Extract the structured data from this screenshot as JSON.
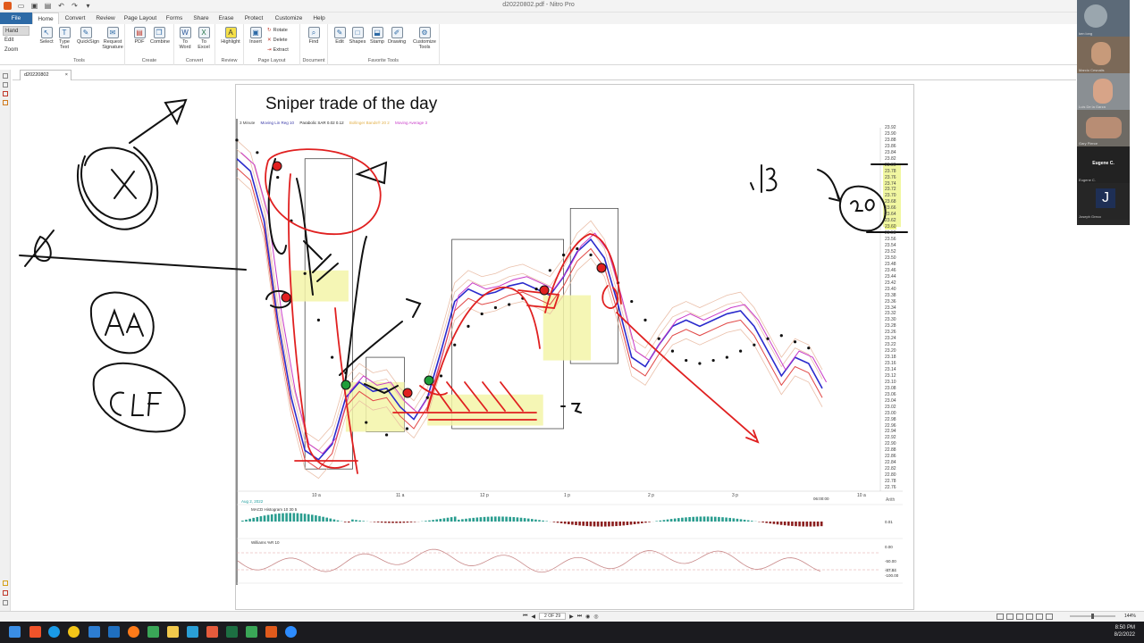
{
  "app": {
    "window_title": "d20220802.pdf - Nitro Pro"
  },
  "menu": {
    "tabs": [
      "File",
      "Home",
      "Convert",
      "Review",
      "Page Layout",
      "Forms",
      "Share",
      "Erase",
      "Protect",
      "Customize",
      "Help"
    ],
    "active": "Home"
  },
  "ribbon": {
    "hand_tools": [
      "Hand",
      "Edit",
      "Zoom"
    ],
    "groups": {
      "tools": {
        "label": "Tools",
        "buttons": [
          "Select",
          "Type Text",
          "QuickSign",
          "Request Signature"
        ]
      },
      "create": {
        "label": "Create",
        "buttons": [
          "PDF",
          "Combine"
        ]
      },
      "convert": {
        "label": "Convert",
        "buttons": [
          "To Word",
          "To Excel"
        ]
      },
      "review": {
        "label": "Review",
        "buttons": [
          "Highlight"
        ]
      },
      "page_layout": {
        "label": "Page Layout",
        "buttons": [
          "Insert"
        ],
        "small": [
          "Rotate",
          "Delete",
          "Extract"
        ]
      },
      "document": {
        "label": "Document",
        "buttons": [
          "Find"
        ]
      },
      "favorite": {
        "label": "Favorite Tools",
        "buttons": [
          "Edit",
          "Shapes",
          "Stamp",
          "Drawing",
          "Customize Tools"
        ]
      }
    }
  },
  "doc_tab": {
    "name": "d20220802",
    "close": "×"
  },
  "page": {
    "title": "Sniper trade of the day"
  },
  "chart": {
    "legend": [
      "3 Minute",
      "Moving Lin Reg 10",
      "Parabolic SAR 0.02 0.12",
      "Bollinger Bands® 20 2",
      "Moving Average 3"
    ],
    "arith": "Arith",
    "date_label": "Aug 2, 2022",
    "last_time": "06:00:00",
    "macd_label": "MACD Histogram 10 30 5",
    "williams_label": "Williams %R 10",
    "macd_value": "0.01",
    "williams_values": [
      "0.00",
      "-50.00",
      "-87.84",
      "-100.00"
    ]
  },
  "chart_data": {
    "type": "line",
    "title": "Sniper trade of the day",
    "x_ticks": [
      "10 a",
      "11 a",
      "12 p",
      "1 p",
      "2 p",
      "3 p",
      "10 a"
    ],
    "y_ticks": [
      "23.92",
      "23.90",
      "23.88",
      "23.86",
      "23.84",
      "23.82",
      "23.80",
      "23.78",
      "23.76",
      "23.74",
      "23.72",
      "23.70",
      "23.68",
      "23.66",
      "23.64",
      "23.62",
      "23.60",
      "23.58",
      "23.56",
      "23.54",
      "23.52",
      "23.50",
      "23.48",
      "23.46",
      "23.44",
      "23.42",
      "23.40",
      "23.38",
      "23.36",
      "23.34",
      "23.32",
      "23.30",
      "23.28",
      "23.26",
      "23.24",
      "23.22",
      "23.20",
      "23.18",
      "23.16",
      "23.14",
      "23.12",
      "23.10",
      "23.08",
      "23.06",
      "23.04",
      "23.02",
      "23.00",
      "22.98",
      "22.96",
      "22.94",
      "22.92",
      "22.90",
      "22.88",
      "22.86",
      "22.84",
      "22.82",
      "22.80",
      "22.78",
      "22.76"
    ],
    "ylim": [
      22.76,
      23.92
    ],
    "series": [
      {
        "name": "Moving Lin Reg 10",
        "points": [
          [
            0,
            23.82
          ],
          [
            10,
            23.78
          ],
          [
            20,
            23.62
          ],
          [
            30,
            23.3
          ],
          [
            40,
            23.05
          ],
          [
            50,
            22.88
          ],
          [
            60,
            22.85
          ],
          [
            70,
            22.9
          ],
          [
            80,
            23.05
          ],
          [
            90,
            23.1
          ],
          [
            100,
            23.07
          ],
          [
            110,
            23.08
          ],
          [
            120,
            23.02
          ],
          [
            130,
            22.98
          ],
          [
            140,
            23.05
          ],
          [
            150,
            23.2
          ],
          [
            160,
            23.36
          ],
          [
            170,
            23.4
          ],
          [
            180,
            23.38
          ],
          [
            190,
            23.39
          ],
          [
            200,
            23.41
          ],
          [
            210,
            23.42
          ],
          [
            220,
            23.4
          ],
          [
            230,
            23.38
          ],
          [
            240,
            23.44
          ],
          [
            250,
            23.52
          ],
          [
            260,
            23.56
          ],
          [
            270,
            23.5
          ],
          [
            280,
            23.35
          ],
          [
            290,
            23.18
          ],
          [
            300,
            23.15
          ],
          [
            310,
            23.22
          ],
          [
            320,
            23.28
          ],
          [
            330,
            23.3
          ],
          [
            340,
            23.28
          ],
          [
            350,
            23.3
          ],
          [
            360,
            23.32
          ],
          [
            370,
            23.33
          ],
          [
            380,
            23.28
          ],
          [
            390,
            23.2
          ],
          [
            400,
            23.12
          ],
          [
            410,
            23.18
          ],
          [
            420,
            23.16
          ],
          [
            430,
            23.08
          ]
        ]
      },
      {
        "name": "Parabolic SAR 0.02 0.12",
        "points": [
          [
            0,
            23.88
          ],
          [
            15,
            23.84
          ],
          [
            30,
            23.76
          ],
          [
            40,
            23.62
          ],
          [
            50,
            23.45
          ],
          [
            60,
            23.3
          ],
          [
            70,
            23.18
          ],
          [
            80,
            23.13
          ],
          [
            95,
            22.97
          ],
          [
            110,
            22.93
          ],
          [
            125,
            22.95
          ],
          [
            140,
            23.05
          ],
          [
            150,
            23.12
          ],
          [
            160,
            23.22
          ],
          [
            170,
            23.28
          ],
          [
            180,
            23.32
          ],
          [
            190,
            23.34
          ],
          [
            200,
            23.35
          ],
          [
            210,
            23.37
          ],
          [
            220,
            23.4
          ],
          [
            230,
            23.46
          ],
          [
            240,
            23.51
          ],
          [
            250,
            23.53
          ],
          [
            260,
            23.51
          ],
          [
            270,
            23.47
          ],
          [
            280,
            23.42
          ],
          [
            290,
            23.36
          ],
          [
            300,
            23.3
          ],
          [
            310,
            23.24
          ],
          [
            320,
            23.2
          ],
          [
            330,
            23.17
          ],
          [
            340,
            23.16
          ],
          [
            350,
            23.17
          ],
          [
            360,
            23.18
          ],
          [
            370,
            23.2
          ],
          [
            380,
            23.22
          ],
          [
            390,
            23.24
          ],
          [
            400,
            23.25
          ],
          [
            410,
            23.23
          ],
          [
            420,
            23.21
          ]
        ]
      }
    ],
    "boxes": [
      {
        "from": 50,
        "to": 85,
        "high": 23.82,
        "low": 22.82
      },
      {
        "from": 95,
        "to": 123,
        "high": 23.18,
        "low": 22.94
      },
      {
        "from": 158,
        "to": 240,
        "high": 23.56,
        "low": 22.95
      },
      {
        "from": 245,
        "to": 280,
        "high": 23.66,
        "low": 23.16
      }
    ],
    "highlight": "23.60"
  },
  "annotations": {
    "ink": [
      "X",
      "AA",
      "CLF",
      ".13",
      "20",
      ".5"
    ]
  },
  "participants": [
    {
      "name": "ken long"
    },
    {
      "name": "Marcio Cesnalis"
    },
    {
      "name": "Luis De la Garza"
    },
    {
      "name": "Gary Pierce"
    },
    {
      "name": "Eugene C.",
      "display": "Eugene C."
    },
    {
      "name": "Joseph Greco",
      "initial": "J"
    }
  ],
  "statusbar": {
    "page_indicator": "2 OF 29",
    "zoom": "144%"
  },
  "taskbar": {
    "time": "8:50 PM",
    "date": "8/2/2022"
  }
}
